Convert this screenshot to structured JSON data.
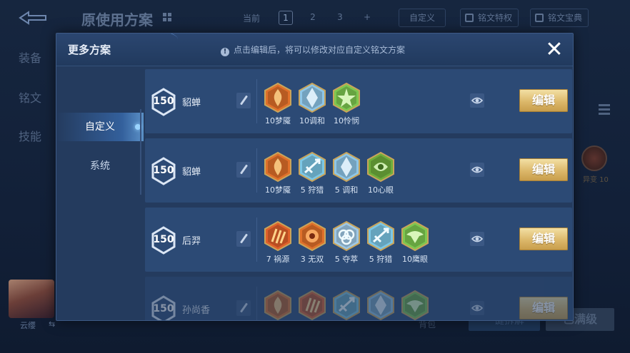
{
  "background": {
    "title": "原使用方案",
    "current_label": "当前",
    "pages": [
      "1",
      "2",
      "3",
      "+"
    ],
    "active_page": "1",
    "custom_label": "自定义",
    "privilege_label": "铭文特权",
    "treasure_label": "铭文宝典",
    "side_tabs": [
      "装备",
      "铭文",
      "技能"
    ],
    "right_rune_label": "异变 10",
    "hero_name": "云缨",
    "bottom_text": "背包",
    "bottom_btn1": "一键拆解",
    "bottom_btn2": "已满级"
  },
  "dialog": {
    "title": "更多方案",
    "notice": "点击编辑后，将可以修改对应自定义铭文方案",
    "close_label": "✕",
    "sidebar": [
      {
        "label": "自定义",
        "active": true
      },
      {
        "label": "系统",
        "active": false
      }
    ],
    "edit_label": "编辑",
    "rows": [
      {
        "level": "150",
        "hero": "貂蝉",
        "runes": [
          {
            "icon": "flame-rune-icon",
            "label": "10梦魇",
            "color": "#e0702a"
          },
          {
            "icon": "crystal-rune-icon",
            "label": "10调和",
            "color": "#8ec6e8"
          },
          {
            "icon": "star-rune-icon",
            "label": "10怜悯",
            "color": "#7ec850"
          }
        ]
      },
      {
        "level": "150",
        "hero": "貂蝉",
        "runes": [
          {
            "icon": "flame-rune-icon",
            "label": "10梦魇",
            "color": "#e0702a"
          },
          {
            "icon": "arrow-rune-icon",
            "label": "5 狩猎",
            "color": "#7cc7e6"
          },
          {
            "icon": "crystal-rune-icon",
            "label": "5 调和",
            "color": "#8ec6e8"
          },
          {
            "icon": "eye-rune-icon",
            "label": "10心眼",
            "color": "#6fae3c"
          }
        ]
      },
      {
        "level": "150",
        "hero": "后羿",
        "runes": [
          {
            "icon": "claw-rune-icon",
            "label": "7 祸源",
            "color": "#e0602a"
          },
          {
            "icon": "fire-rune-icon",
            "label": "3 无双",
            "color": "#e0702a"
          },
          {
            "icon": "knot-rune-icon",
            "label": "5 夺萃",
            "color": "#9fc8e6"
          },
          {
            "icon": "arrow-rune-icon",
            "label": "5 狩猎",
            "color": "#7cc7e6"
          },
          {
            "icon": "hawk-rune-icon",
            "label": "10鹰眼",
            "color": "#7ec850"
          }
        ]
      },
      {
        "level": "150",
        "hero": "孙尚香",
        "runes": [
          {
            "icon": "flame-rune-icon",
            "label": "",
            "color": "#e0702a"
          },
          {
            "icon": "claw-rune-icon",
            "label": "",
            "color": "#e0602a"
          },
          {
            "icon": "arrow-rune-icon",
            "label": "",
            "color": "#7cc7e6"
          },
          {
            "icon": "crystal-rune-icon",
            "label": "",
            "color": "#8ec6e8"
          },
          {
            "icon": "hawk-rune-icon",
            "label": "",
            "color": "#7ec850"
          }
        ]
      }
    ]
  }
}
